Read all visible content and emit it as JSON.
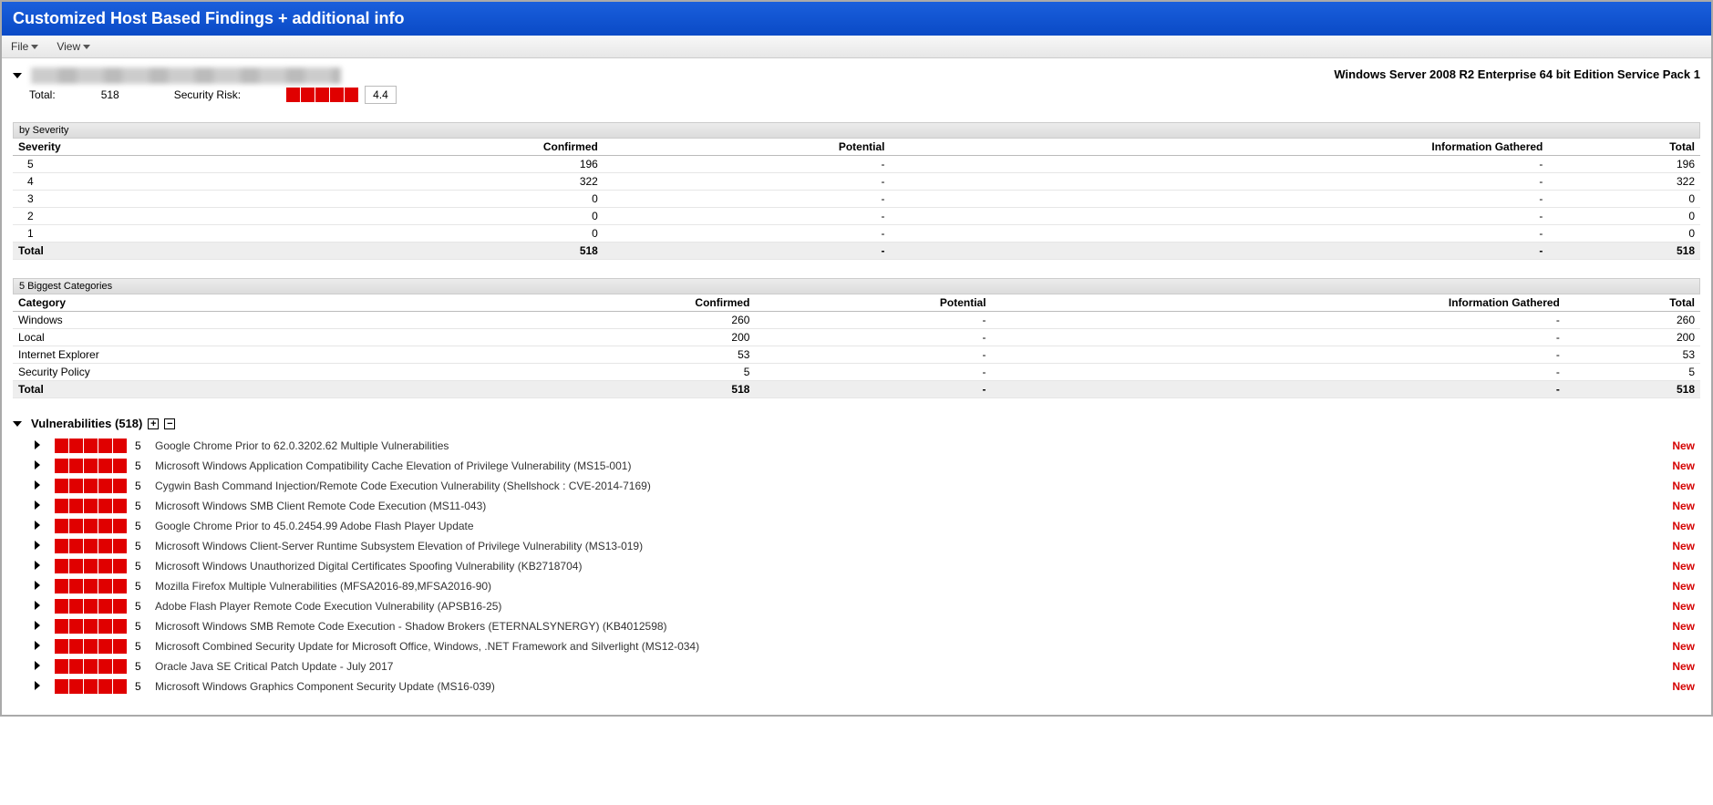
{
  "banner": {
    "title": "Customized Host Based Findings + additional info"
  },
  "menubar": {
    "file": "File",
    "view": "View"
  },
  "host": {
    "os": "Windows Server 2008 R2 Enterprise 64 bit Edition Service Pack 1",
    "total_label": "Total:",
    "total_value": "518",
    "risk_label": "Security Risk:",
    "risk_value": "4.4"
  },
  "severity_section": {
    "label": "by Severity",
    "headers": {
      "severity": "Severity",
      "confirmed": "Confirmed",
      "potential": "Potential",
      "info": "Information Gathered",
      "total": "Total"
    },
    "rows": [
      {
        "severity": "5",
        "confirmed": "196",
        "potential": "-",
        "info": "-",
        "total": "196"
      },
      {
        "severity": "4",
        "confirmed": "322",
        "potential": "-",
        "info": "-",
        "total": "322"
      },
      {
        "severity": "3",
        "confirmed": "0",
        "potential": "-",
        "info": "-",
        "total": "0"
      },
      {
        "severity": "2",
        "confirmed": "0",
        "potential": "-",
        "info": "-",
        "total": "0"
      },
      {
        "severity": "1",
        "confirmed": "0",
        "potential": "-",
        "info": "-",
        "total": "0"
      }
    ],
    "totals": {
      "severity": "Total",
      "confirmed": "518",
      "potential": "-",
      "info": "-",
      "total": "518"
    }
  },
  "categories_section": {
    "label": "5 Biggest Categories",
    "headers": {
      "category": "Category",
      "confirmed": "Confirmed",
      "potential": "Potential",
      "info": "Information Gathered",
      "total": "Total"
    },
    "rows": [
      {
        "category": "Windows",
        "confirmed": "260",
        "potential": "-",
        "info": "-",
        "total": "260"
      },
      {
        "category": "Local",
        "confirmed": "200",
        "potential": "-",
        "info": "-",
        "total": "200"
      },
      {
        "category": "Internet Explorer",
        "confirmed": "53",
        "potential": "-",
        "info": "-",
        "total": "53"
      },
      {
        "category": "Security Policy",
        "confirmed": "5",
        "potential": "-",
        "info": "-",
        "total": "5"
      }
    ],
    "totals": {
      "category": "Total",
      "confirmed": "518",
      "potential": "-",
      "info": "-",
      "total": "518"
    }
  },
  "vuln_section": {
    "header": "Vulnerabilities (518)",
    "items": [
      {
        "sev": "5",
        "title": "Google Chrome Prior to 62.0.3202.62 Multiple Vulnerabilities",
        "status": "New"
      },
      {
        "sev": "5",
        "title": "Microsoft Windows Application Compatibility Cache Elevation of Privilege Vulnerability (MS15-001)",
        "status": "New"
      },
      {
        "sev": "5",
        "title": "Cygwin Bash Command Injection/Remote Code Execution Vulnerability (Shellshock : CVE-2014-7169)",
        "status": "New"
      },
      {
        "sev": "5",
        "title": "Microsoft Windows SMB Client Remote Code Execution (MS11-043)",
        "status": "New"
      },
      {
        "sev": "5",
        "title": "Google Chrome Prior to 45.0.2454.99 Adobe Flash Player Update",
        "status": "New"
      },
      {
        "sev": "5",
        "title": "Microsoft Windows Client-Server Runtime Subsystem Elevation of Privilege Vulnerability (MS13-019)",
        "status": "New"
      },
      {
        "sev": "5",
        "title": "Microsoft Windows Unauthorized Digital Certificates Spoofing Vulnerability (KB2718704)",
        "status": "New"
      },
      {
        "sev": "5",
        "title": "Mozilla Firefox Multiple Vulnerabilities (MFSA2016-89,MFSA2016-90)",
        "status": "New"
      },
      {
        "sev": "5",
        "title": "Adobe Flash Player Remote Code Execution Vulnerability (APSB16-25)",
        "status": "New"
      },
      {
        "sev": "5",
        "title": "Microsoft Windows SMB Remote Code Execution - Shadow Brokers (ETERNALSYNERGY) (KB4012598)",
        "status": "New"
      },
      {
        "sev": "5",
        "title": "Microsoft Combined Security Update for Microsoft Office, Windows, .NET Framework and Silverlight (MS12-034)",
        "status": "New"
      },
      {
        "sev": "5",
        "title": "Oracle Java SE Critical Patch Update - July 2017",
        "status": "New"
      },
      {
        "sev": "5",
        "title": "Microsoft Windows Graphics Component Security Update (MS16-039)",
        "status": "New"
      }
    ]
  }
}
